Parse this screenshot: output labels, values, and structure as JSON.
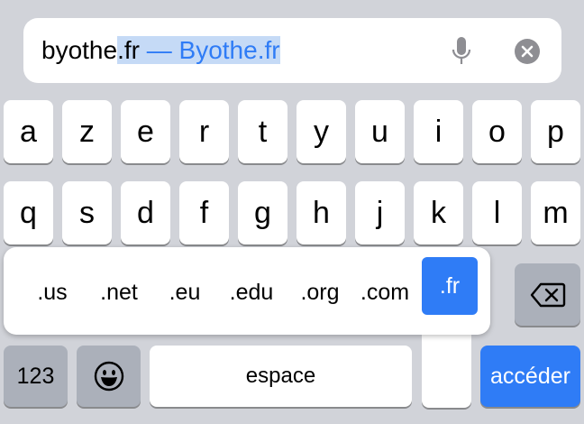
{
  "url_bar": {
    "typed": "byothe",
    "selected_suffix": ".fr",
    "suggestion": " — Byothe.fr"
  },
  "row1": [
    "a",
    "z",
    "e",
    "r",
    "t",
    "y",
    "u",
    "i",
    "o",
    "p"
  ],
  "row2": [
    "q",
    "s",
    "d",
    "f",
    "g",
    "h",
    "j",
    "k",
    "l",
    "m"
  ],
  "tld_popup": {
    "options": [
      ".us",
      ".net",
      ".eu",
      ".edu",
      ".org",
      ".com",
      ".fr"
    ],
    "active": ".fr"
  },
  "bottom_row": {
    "numbers_label": "123",
    "space_label": "espace",
    "go_label": "accéder"
  },
  "colors": {
    "keyboard_bg": "#d1d3d9",
    "key_bg": "#ffffff",
    "key_dark_bg": "#abb0ba",
    "accent": "#2f7cf6",
    "selection": "#c5daf6"
  },
  "icons": {
    "mic": "microphone-icon",
    "clear": "clear-text-icon",
    "backspace": "backspace-icon",
    "emoji": "emoji-icon"
  }
}
